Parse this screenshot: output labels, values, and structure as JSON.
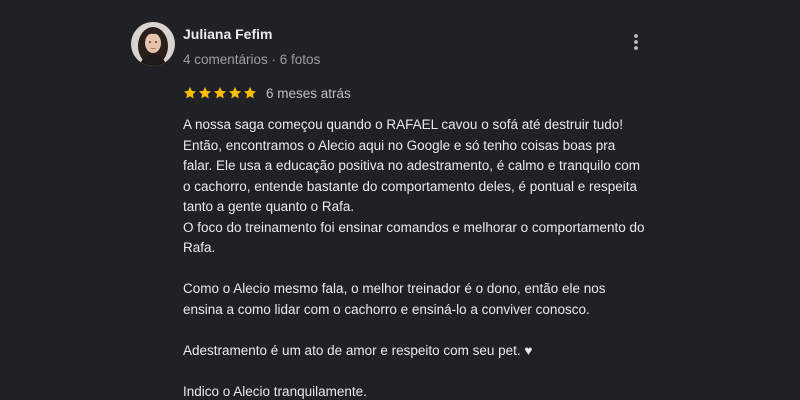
{
  "review": {
    "author": "Juliana Fefim",
    "meta": "4 comentários · 6 fotos",
    "rating": 5,
    "rating_max": 5,
    "time": "6 meses atrás",
    "lines": [
      "A nossa saga começou quando o RAFAEL cavou o sofá até destruir tudo!",
      "Então, encontramos o Alecio aqui no Google e só tenho coisas boas pra",
      "falar. Ele usa a educação positiva no adestramento, é calmo e tranquilo com",
      "o cachorro, entende bastante do comportamento deles, é pontual e respeita",
      "tanto a gente quanto o Rafa.",
      "O foco do treinamento foi ensinar comandos e melhorar o comportamento do",
      "Rafa.",
      "",
      "Como o Alecio mesmo fala, o melhor treinador é o dono, então ele nos",
      "ensina a como lidar com o cachorro e ensiná-lo a conviver conosco.",
      "",
      "Adestramento é um ato de amor e respeito com seu pet. ♥",
      "",
      "Indico o Alecio tranquilamente."
    ]
  },
  "icons": {
    "menu": "more-vert-icon",
    "star": "star-icon",
    "avatar": "profile-photo"
  },
  "colors": {
    "background": "#202124",
    "star": "#fbbc04",
    "text": "#e8eaed",
    "muted": "#9aa0a6"
  }
}
